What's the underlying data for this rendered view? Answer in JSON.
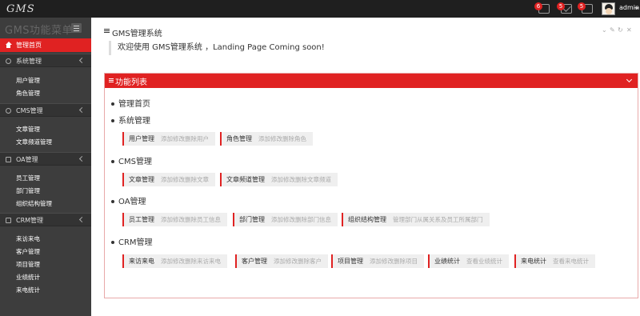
{
  "header": {
    "logo_main": "GMS",
    "badges": [
      "6",
      "5",
      "5"
    ],
    "user": "admin"
  },
  "sidebar": {
    "title": "GMS功能菜单",
    "active_item": "管理首页",
    "groups": [
      {
        "label": "系统管理",
        "items": [
          "用户管理",
          "角色管理"
        ]
      },
      {
        "label": "CMS管理",
        "items": [
          "文章管理",
          "文章频道管理"
        ]
      },
      {
        "label": "OA管理",
        "items": [
          "员工管理",
          "部门管理",
          "组织结构管理"
        ]
      },
      {
        "label": "CRM管理",
        "items": [
          "来访来电",
          "客户管理",
          "项目管理",
          "业绩统计",
          "来电统计"
        ]
      }
    ]
  },
  "main": {
    "title": "GMS管理系统",
    "welcome": "欢迎使用 GMS管理系统 ，Landing Page Coming soon!",
    "func_title": "功能列表",
    "sections": [
      {
        "label": "管理首页",
        "items": []
      },
      {
        "label": "系统管理",
        "items": [
          {
            "name": "用户管理",
            "desc": "添加修改删除用户"
          },
          {
            "name": "角色管理",
            "desc": "添加修改删除角色"
          }
        ]
      },
      {
        "label": "CMS管理",
        "items": [
          {
            "name": "文章管理",
            "desc": "添加修改删除文章"
          },
          {
            "name": "文章频道管理",
            "desc": "添加修改删除文章频道"
          }
        ]
      },
      {
        "label": "OA管理",
        "items": [
          {
            "name": "员工管理",
            "desc": "添加修改删除员工信息"
          },
          {
            "name": "部门管理",
            "desc": "添加修改删除部门信息"
          },
          {
            "name": "组织结构管理",
            "desc": "管理部门从属关系及员工所属部门"
          }
        ]
      },
      {
        "label": "CRM管理",
        "items": [
          {
            "name": "来访来电",
            "desc": "添加修改删除来访来电"
          },
          {
            "name": "客户管理",
            "desc": "添加修改删除客户"
          },
          {
            "name": "项目管理",
            "desc": "添加修改删除项目"
          },
          {
            "name": "业绩统计",
            "desc": "查看业绩统计"
          },
          {
            "name": "来电统计",
            "desc": "查看来电统计"
          }
        ]
      }
    ]
  },
  "colors": {
    "accent": "#e02222",
    "sidebar": "#3d3d3d",
    "topbar": "#1f1f1f"
  }
}
